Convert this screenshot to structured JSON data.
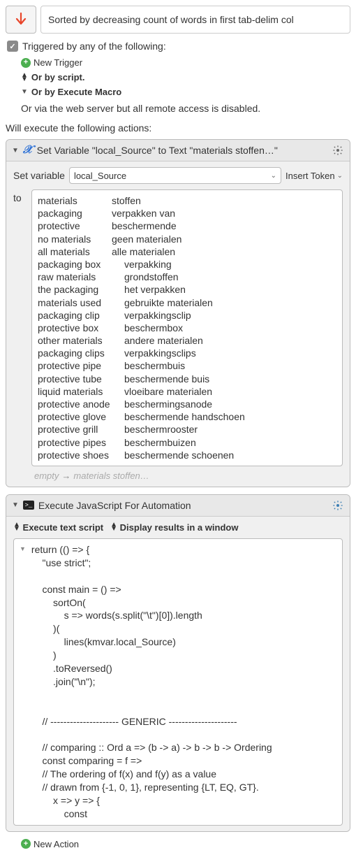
{
  "header": {
    "title": "Sorted by decreasing count of words in first tab-delim col"
  },
  "trigger": {
    "checkbox_label": "Triggered by any of the following:",
    "new_trigger": "New Trigger",
    "or_by_script": "Or by script.",
    "or_by_execute_macro": "Or by Execute Macro",
    "or_via_web": "Or via the web server but all remote access is disabled."
  },
  "execute_label": "Will execute the following actions:",
  "action1": {
    "title": "Set Variable \"local_Source\" to Text \"materials\tstoffen…\"",
    "set_variable_label": "Set variable",
    "variable_name": "local_Source",
    "insert_token": "Insert Token",
    "to_label": "to",
    "lines": [
      [
        "materials",
        "stoffen"
      ],
      [
        "packaging",
        "verpakken van"
      ],
      [
        "protective",
        "beschermende"
      ],
      [
        "no materials",
        "geen materialen"
      ],
      [
        "all materials",
        "alle materialen"
      ],
      [
        "packaging box",
        "verpakking"
      ],
      [
        "raw materials",
        "grondstoffen"
      ],
      [
        "the packaging",
        "het verpakken"
      ],
      [
        "materials used",
        "gebruikte materialen"
      ],
      [
        "packaging clip",
        "verpakkingsclip"
      ],
      [
        "protective box",
        "beschermbox"
      ],
      [
        "other materials",
        "andere materialen"
      ],
      [
        "packaging clips",
        "verpakkingsclips"
      ],
      [
        "protective pipe",
        "beschermbuis"
      ],
      [
        "protective tube",
        "beschermende buis"
      ],
      [
        "liquid materials",
        "vloeibare materialen"
      ],
      [
        "protective anode",
        "beschermingsanode"
      ],
      [
        "protective glove",
        "beschermende handschoen"
      ],
      [
        "protective grill",
        "beschermrooster"
      ],
      [
        "protective pipes",
        "beschermbuizen"
      ],
      [
        "protective shoes",
        "beschermende schoenen"
      ]
    ],
    "preview_empty": "empty",
    "preview_result": "materials\t\tstoffen…"
  },
  "action2": {
    "title": "Execute JavaScript For Automation",
    "opt1": "Execute text script",
    "opt2": "Display results in a window",
    "code": "return (() => {\n    \"use strict\";\n\n    const main = () =>\n        sortOn(\n            s => words(s.split(\"\\t\")[0]).length\n        )(\n            lines(kmvar.local_Source)\n        )\n        .toReversed()\n        .join(\"\\n\");\n\n\n    // --------------------- GENERIC ---------------------\n\n    // comparing :: Ord a => (b -> a) -> b -> b -> Ordering\n    const comparing = f =>\n    // The ordering of f(x) and f(y) as a value\n    // drawn from {-1, 0, 1}, representing {LT, EQ, GT}.\n        x => y => {\n            const"
  },
  "new_action": "New Action"
}
